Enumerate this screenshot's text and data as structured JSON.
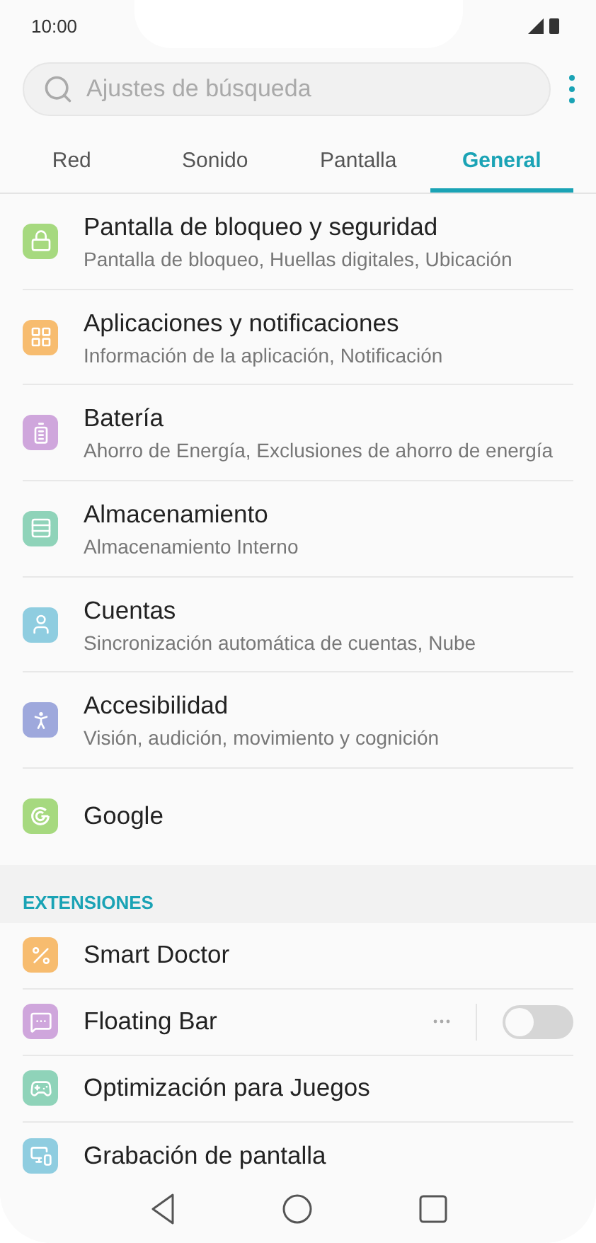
{
  "status_bar": {
    "time": "10:00"
  },
  "search": {
    "placeholder": "Ajustes de búsqueda"
  },
  "tabs": [
    {
      "label": "Red",
      "selected": false
    },
    {
      "label": "Sonido",
      "selected": false
    },
    {
      "label": "Pantalla",
      "selected": false
    },
    {
      "label": "General",
      "selected": true
    }
  ],
  "items": [
    {
      "color": "#a6d97f",
      "title": "Pantalla de bloqueo y seguridad",
      "subtitle": "Pantalla de bloqueo, Huellas digitales, Ubicación"
    },
    {
      "color": "#f7bc6f",
      "title": "Aplicaciones y notificaciones",
      "subtitle": "Información de la aplicación, Notificación"
    },
    {
      "color": "#cfa6dc",
      "title": "Batería",
      "subtitle": "Ahorro de Energía, Exclusiones de ahorro de energía"
    },
    {
      "color": "#8fd3b9",
      "title": "Almacenamiento",
      "subtitle": "Almacenamiento Interno"
    },
    {
      "color": "#8fcde0",
      "title": "Cuentas",
      "subtitle": "Sincronización automática de cuentas, Nube"
    },
    {
      "color": "#9ea8dc",
      "title": "Accesibilidad",
      "subtitle": "Visión, audición, movimiento y cognición"
    },
    {
      "color": "#a6d97f",
      "title": "Google"
    }
  ],
  "section": {
    "title": "EXTENSIONES"
  },
  "extensions": [
    {
      "kind": "plain",
      "color": "#f7bc6f",
      "title": "Smart Doctor"
    },
    {
      "kind": "toggle",
      "color": "#cfa6dc",
      "title": "Floating Bar",
      "on": false
    },
    {
      "kind": "plain",
      "color": "#8fd3b9",
      "title": "Optimización para Juegos"
    },
    {
      "kind": "plain",
      "color": "#8fcde0",
      "title": "Grabación de pantalla"
    }
  ]
}
